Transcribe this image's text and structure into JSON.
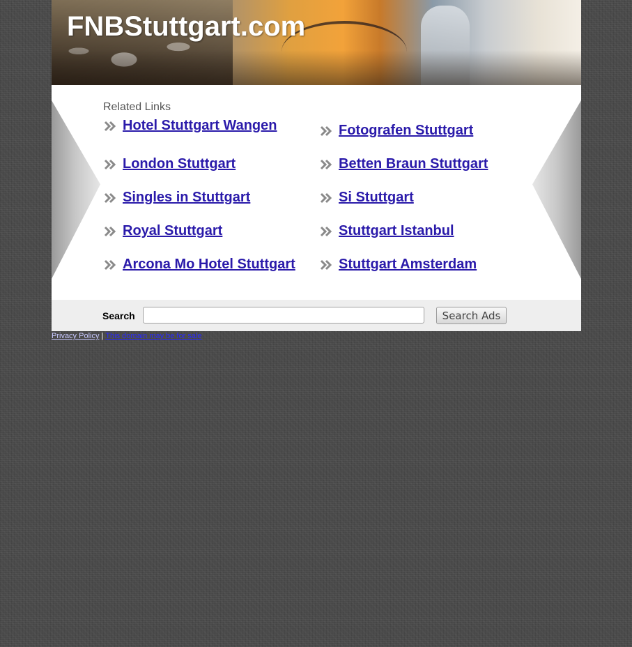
{
  "site": {
    "title": "FNBStuttgart.com"
  },
  "related": {
    "label": "Related Links",
    "left": [
      "Hotel Stuttgart Wangen",
      "London Stuttgart",
      "Singles in Stuttgart",
      "Royal Stuttgart",
      "Arcona Mo Hotel Stuttgart"
    ],
    "right": [
      "Fotografen Stuttgart",
      "Betten Braun Stuttgart",
      "Si Stuttgart",
      "Stuttgart Istanbul",
      "Stuttgart Amsterdam"
    ]
  },
  "search": {
    "label": "Search",
    "value": "",
    "button_label": "Search Ads"
  },
  "footer": {
    "privacy": "Privacy Policy",
    "separator": "|",
    "sale": "This domain may be for sale"
  },
  "colors": {
    "link": "#2a1aaa",
    "background": "#4a4a4a",
    "search_bar": "#eeeeee"
  },
  "icons": {
    "link_bullet": "double-chevron-right-icon"
  }
}
